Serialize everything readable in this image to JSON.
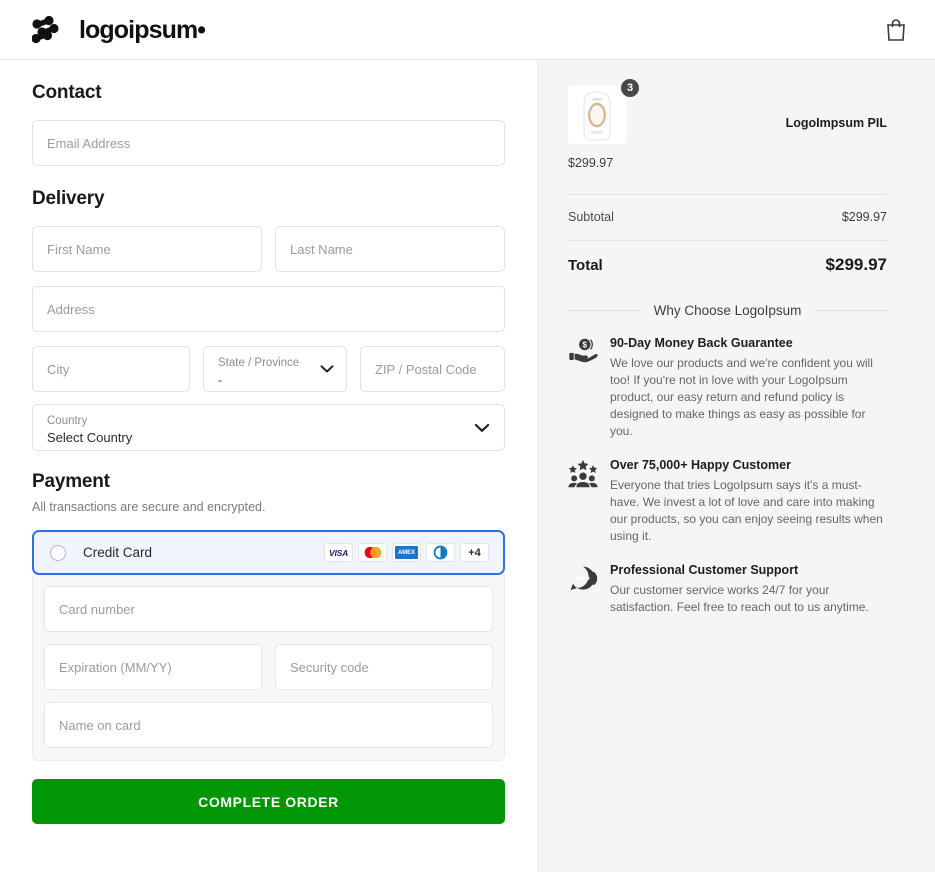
{
  "header": {
    "brand_name": "logoipsum",
    "brand_dot": "•",
    "logo_icon": "logoipsum-dots-mark",
    "cart_icon": "shopping-bag-icon"
  },
  "checkout": {
    "contact": {
      "title": "Contact",
      "email_placeholder": "Email Address",
      "email_value": ""
    },
    "delivery": {
      "title": "Delivery",
      "first_name_placeholder": "First Name",
      "last_name_placeholder": "Last Name",
      "address_placeholder": "Address",
      "city_placeholder": "City",
      "state_label": "State / Province",
      "state_value": "-",
      "zip_placeholder": "ZIP / Postal Code",
      "country_label": "Country",
      "country_value": "Select Country",
      "chevron_icon": "chevron-down-icon"
    },
    "payment": {
      "title": "Payment",
      "note": "All transactions are secure and encrypted.",
      "method_label": "Credit Card",
      "method_selected": false,
      "radio_icon": "radio-unchecked-icon",
      "accent_border": "#2f6fe4",
      "accent_background": "#eff4fd",
      "brands": [
        {
          "name": "visa-icon",
          "label": "VISA"
        },
        {
          "name": "mastercard-icon",
          "label": ""
        },
        {
          "name": "amex-icon",
          "label": "AMEX"
        },
        {
          "name": "diners-club-icon",
          "label": ""
        },
        {
          "name": "more-brands-badge",
          "label": "+4"
        }
      ],
      "card_number_placeholder": "Card number",
      "expiration_placeholder": "Expiration (MM/YY)",
      "security_code_placeholder": "Security code",
      "name_on_card_placeholder": "Name on card"
    },
    "submit_label": "COMPLETE ORDER",
    "submit_color": "#009605"
  },
  "summary": {
    "product": {
      "name": "LogoImpsum PIL",
      "quantity": "3",
      "price": "$299.97",
      "image_icon": "ipl-device-thumbnail"
    },
    "subtotal_label": "Subtotal",
    "subtotal_value": "$299.97",
    "total_label": "Total",
    "total_value": "$299.97",
    "why_title": "Why Choose LogoIpsum",
    "benefits": [
      {
        "icon": "hand-holding-coin-icon",
        "title": "90-Day Money Back Guarantee",
        "body": "We love our products and we're confident you will too! If you're not in love with your LogoIpsum product, our easy return and refund policy is designed to make things as easy as possible for you."
      },
      {
        "icon": "happy-customers-stars-icon",
        "title": "Over 75,000+ Happy Customer",
        "body": "Everyone that tries LogoIpsum says it's a must-have. We invest a lot of love and care into making our products, so you can enjoy seeing results when using it."
      },
      {
        "icon": "headset-support-icon",
        "title": "Professional Customer Support",
        "body": "Our customer service works 24/7 for your satisfaction. Feel free to reach out to us anytime."
      }
    ]
  }
}
